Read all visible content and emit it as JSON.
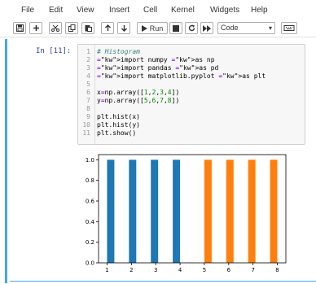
{
  "menu": [
    "File",
    "Edit",
    "View",
    "Insert",
    "Cell",
    "Kernel",
    "Widgets",
    "Help"
  ],
  "toolbar": {
    "run_label": "Run",
    "cell_type": "Code",
    "icons": [
      "save-icon",
      "plus-icon",
      "cut-icon",
      "copy-icon",
      "paste-icon",
      "up-arrow-icon",
      "down-arrow-icon",
      "run-icon",
      "stop-icon",
      "restart-icon",
      "fast-forward-icon",
      "keyboard-icon"
    ]
  },
  "cell": {
    "prompt": "In [11]:",
    "lines": [
      {
        "n": "1",
        "code": "# Histogram"
      },
      {
        "n": "2",
        "code": "import numpy as np"
      },
      {
        "n": "3",
        "code": "import pandas as pd"
      },
      {
        "n": "4",
        "code": "import matplotlib.pyplot as plt"
      },
      {
        "n": "5",
        "code": ""
      },
      {
        "n": "6",
        "code": "x=np.array([1,2,3,4])"
      },
      {
        "n": "7",
        "code": "y=np.array([5,6,7,8])"
      },
      {
        "n": "8",
        "code": ""
      },
      {
        "n": "9",
        "code": "plt.hist(x)"
      },
      {
        "n": "10",
        "code": "plt.hist(y)"
      },
      {
        "n": "11",
        "code": "plt.show()"
      }
    ]
  },
  "chart_data": {
    "type": "bar",
    "title": "",
    "xlabel": "",
    "ylabel": "",
    "xlim": [
      0.65,
      8.35
    ],
    "ylim": [
      0.0,
      1.05
    ],
    "xticks": [
      "1",
      "2",
      "3",
      "4",
      "5",
      "6",
      "7",
      "8"
    ],
    "yticks": [
      "0.0",
      "0.2",
      "0.4",
      "0.6",
      "0.8",
      "1.0"
    ],
    "series": [
      {
        "color": "#1f77b4",
        "bins": [
          [
            1.0,
            1.3
          ],
          [
            1.9,
            2.2
          ],
          [
            2.8,
            3.1
          ],
          [
            3.7,
            4.0
          ]
        ],
        "values": [
          1,
          1,
          1,
          1
        ]
      },
      {
        "color": "#ff7f0e",
        "bins": [
          [
            5.0,
            5.3
          ],
          [
            5.9,
            6.2
          ],
          [
            6.8,
            7.1
          ],
          [
            7.7,
            8.0
          ]
        ],
        "values": [
          1,
          1,
          1,
          1
        ]
      }
    ]
  }
}
